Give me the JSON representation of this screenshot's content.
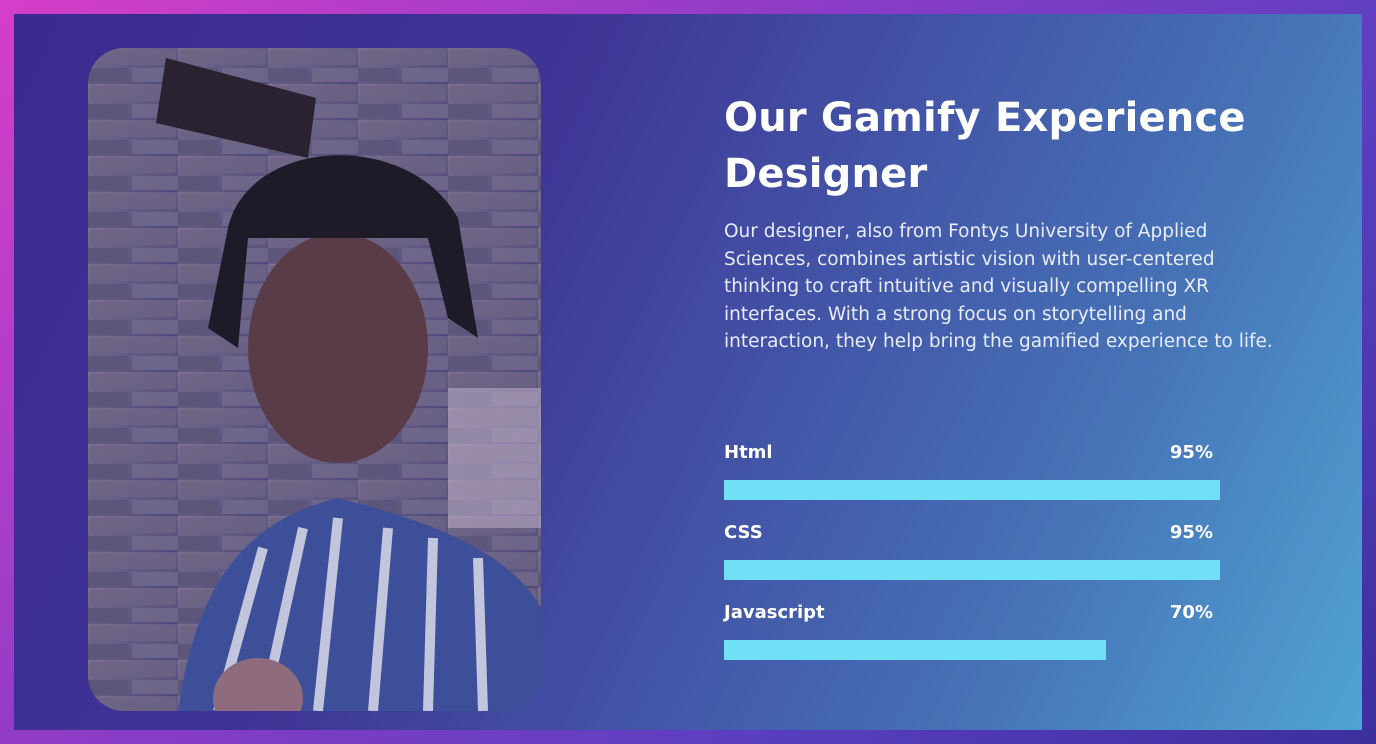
{
  "title": "Our Gamify Experience Designer",
  "description": "Our designer, also from Fontys University of Applied Sciences, combines artistic vision with user-centered thinking to craft intuitive and visually compelling XR interfaces. With a strong focus on storytelling and interaction, they help bring the gamified experience to life.",
  "colors": {
    "bar": "#6fe0f6",
    "text": "#ffffff"
  },
  "skills": [
    {
      "name": "Html",
      "percent_label": "95%",
      "value": 100
    },
    {
      "name": "CSS",
      "percent_label": "95%",
      "value": 100
    },
    {
      "name": "Javascript",
      "percent_label": "70%",
      "value": 77
    }
  ]
}
